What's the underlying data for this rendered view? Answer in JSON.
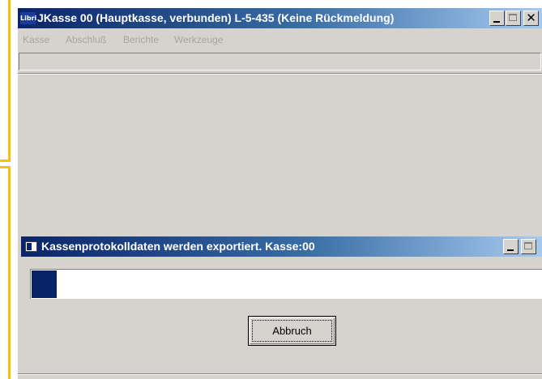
{
  "main_window": {
    "app_icon_text": "Libri",
    "title": "JKasse 00 (Hauptkasse, verbunden)  L-5-435 (Keine Rückmeldung)",
    "close_glyph": "✕"
  },
  "menu": {
    "items": [
      {
        "label": "Kasse"
      },
      {
        "label": "Abschluß"
      },
      {
        "label": "Berichte"
      },
      {
        "label": "Werkzeuge"
      }
    ]
  },
  "export_dialog": {
    "title": "Kassenprotokolldaten werden exportiert. Kasse:00",
    "progress_fraction": 0.05,
    "cancel_label": "Abbruch"
  },
  "colors": {
    "titlebar_start": "#0a246a",
    "titlebar_end": "#a6caf0",
    "window_face": "#d6d3ce",
    "progress_fill": "#0a246a",
    "annotation": "#f5c400"
  },
  "icons": {
    "main_app": "libri-app-icon",
    "dialog": "window-icon",
    "minimize": "minimize-icon",
    "maximize": "maximize-icon",
    "close": "close-icon"
  }
}
